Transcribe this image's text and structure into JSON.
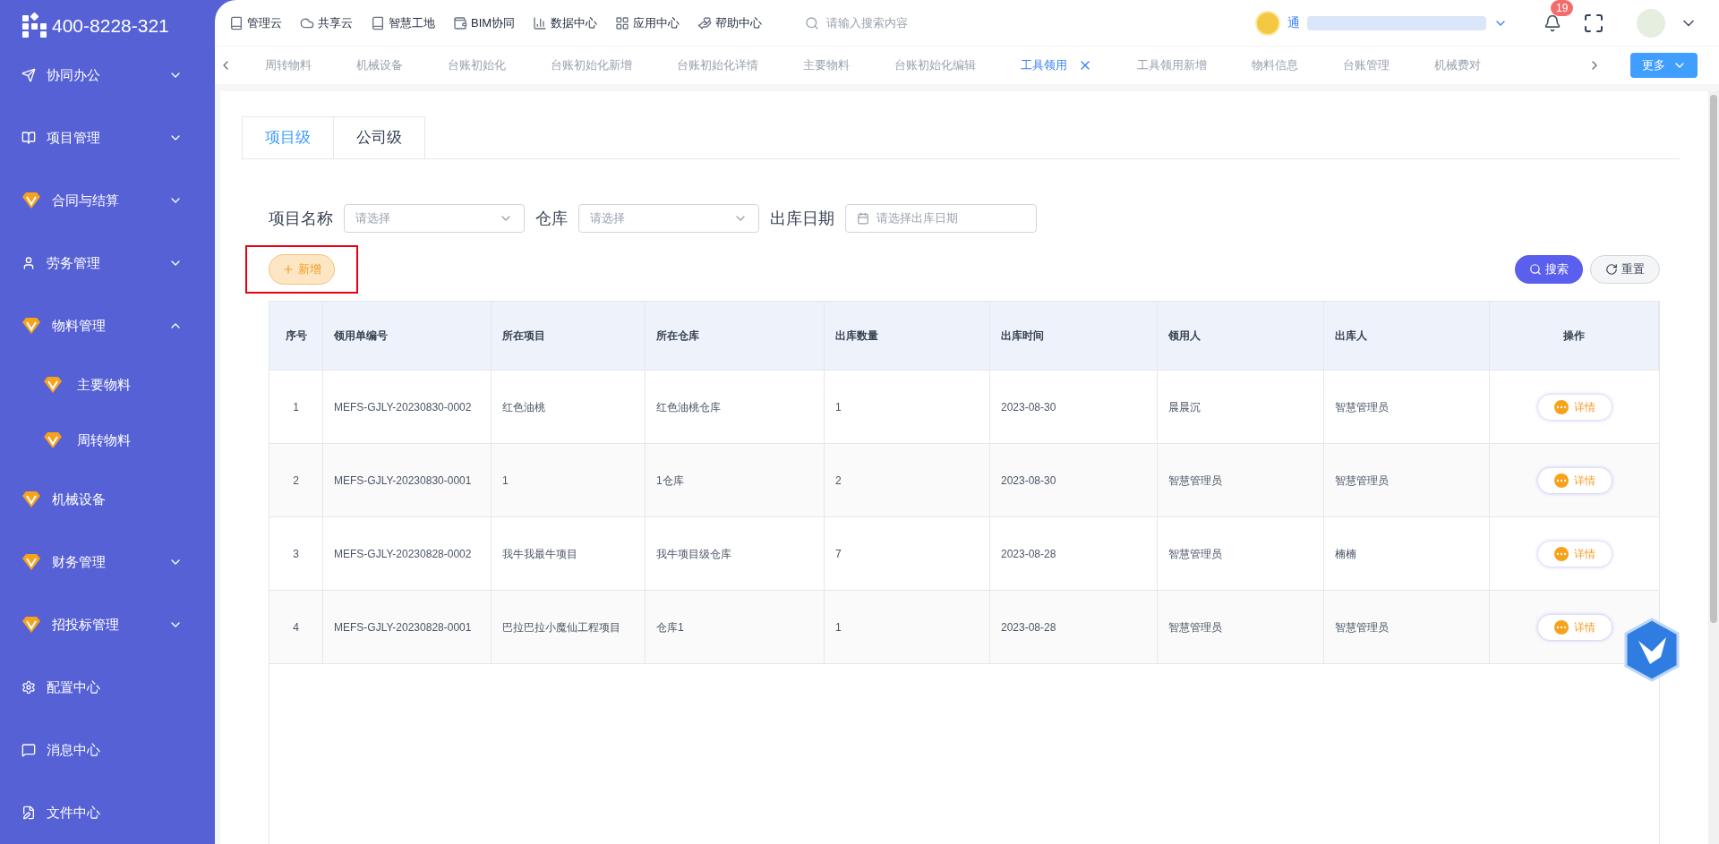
{
  "brand": {
    "phone": "400-8228-321"
  },
  "sidebar": {
    "items": [
      {
        "label": "协同办公",
        "kind": "send",
        "expanded": false
      },
      {
        "label": "项目管理",
        "kind": "book",
        "expanded": false
      },
      {
        "label": "合同与结算",
        "kind": "gem",
        "expanded": false
      },
      {
        "label": "劳务管理",
        "kind": "user",
        "expanded": false
      },
      {
        "label": "物料管理",
        "kind": "gem",
        "expanded": true,
        "children": [
          {
            "label": "主要物料",
            "kind": "gem"
          },
          {
            "label": "周转物料",
            "kind": "gem"
          }
        ]
      },
      {
        "label": "机械设备",
        "kind": "gem"
      },
      {
        "label": "财务管理",
        "kind": "gem",
        "expanded": false
      },
      {
        "label": "招投标管理",
        "kind": "gem",
        "expanded": false
      },
      {
        "label": "配置中心",
        "kind": "gear"
      },
      {
        "label": "消息中心",
        "kind": "message"
      },
      {
        "label": "文件中心",
        "kind": "file"
      }
    ]
  },
  "top_nav": {
    "items": [
      {
        "label": "管理云",
        "kind": "book"
      },
      {
        "label": "共享云",
        "kind": "cloud"
      },
      {
        "label": "智慧工地",
        "kind": "book"
      },
      {
        "label": "BIM协同",
        "kind": "wallet"
      },
      {
        "label": "数据中心",
        "kind": "chart"
      },
      {
        "label": "应用中心",
        "kind": "grid"
      },
      {
        "label": "帮助中心",
        "kind": "hand"
      }
    ],
    "search": {
      "placeholder": "请输入搜索内容"
    },
    "user_name": "通",
    "notification_count": "19"
  },
  "page_tabs": {
    "items": [
      {
        "label": "周转物料",
        "selected": false
      },
      {
        "label": "机械设备",
        "selected": false
      },
      {
        "label": "台账初始化",
        "selected": false
      },
      {
        "label": "台账初始化新增",
        "selected": false
      },
      {
        "label": "台账初始化详情",
        "selected": false
      },
      {
        "label": "主要物料",
        "selected": false
      },
      {
        "label": "台账初始化编辑",
        "selected": false
      },
      {
        "label": "工具领用",
        "selected": true
      },
      {
        "label": "工具领用新增",
        "selected": false
      },
      {
        "label": "物料信息",
        "selected": false
      },
      {
        "label": "台账管理",
        "selected": false
      },
      {
        "label": "机械费对",
        "selected": false
      }
    ],
    "more": "更多"
  },
  "level_tabs": [
    {
      "label": "项目级",
      "selected": true
    },
    {
      "label": "公司级",
      "selected": false
    }
  ],
  "filters": [
    {
      "label": "项目名称",
      "kind": "select",
      "placeholder": "请选择"
    },
    {
      "label": "仓库",
      "kind": "select",
      "placeholder": "请选择"
    },
    {
      "label": "出库日期",
      "kind": "date",
      "placeholder": "请选择出库日期"
    }
  ],
  "add_button": "新增",
  "search_button": "搜索",
  "reset_button": "重置",
  "table": {
    "columns": [
      "序号",
      "领用单编号",
      "所在项目",
      "所在仓库",
      "出库数量",
      "出库时间",
      "领用人",
      "出库人",
      "操作"
    ],
    "rows": [
      {
        "cells": [
          "1",
          "MEFS-GJLY-20230830-0002",
          "红色油桃",
          "红色油桃仓库",
          "1",
          "2023-08-30",
          "晨晨沉",
          "智慧管理员"
        ],
        "action": "详情"
      },
      {
        "cells": [
          "2",
          "MEFS-GJLY-20230830-0001",
          "1",
          "1仓库",
          "2",
          "2023-08-30",
          "智慧管理员",
          "智慧管理员"
        ],
        "action": "详情"
      },
      {
        "cells": [
          "3",
          "MEFS-GJLY-20230828-0002",
          "我牛我最牛项目",
          "我牛项目级仓库",
          "7",
          "2023-08-28",
          "智慧管理员",
          "楠楠"
        ],
        "action": "详情"
      },
      {
        "cells": [
          "4",
          "MEFS-GJLY-20230828-0001",
          "巴拉巴拉小魔仙工程项目",
          "仓库1",
          "1",
          "2023-08-28",
          "智慧管理员",
          "智慧管理员"
        ],
        "action": "详情"
      }
    ]
  }
}
